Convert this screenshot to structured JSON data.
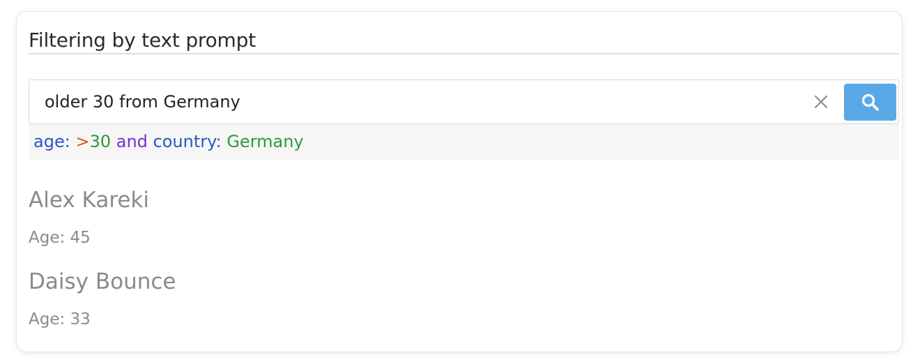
{
  "panel": {
    "title": "Filtering by text prompt"
  },
  "search": {
    "value": "older 30 from Germany",
    "placeholder": "",
    "clear_icon": "close-icon",
    "submit_icon": "search-icon",
    "button_color": "#5aa9e6"
  },
  "parsed_query": {
    "tokens": [
      {
        "text": "age",
        "role": "field",
        "color": "#2b55c9"
      },
      {
        "text": ":",
        "role": "separator",
        "color": "#2b55c9"
      },
      {
        "text": " ",
        "role": "space",
        "color": "#2b55c9"
      },
      {
        "text": ">",
        "role": "operator",
        "color": "#d4571c"
      },
      {
        "text": "30",
        "role": "value",
        "color": "#2d9a3a"
      },
      {
        "text": " ",
        "role": "space",
        "color": "#2b55c9"
      },
      {
        "text": "and",
        "role": "logical",
        "color": "#7b2fc9"
      },
      {
        "text": " ",
        "role": "space",
        "color": "#2b55c9"
      },
      {
        "text": "country",
        "role": "field",
        "color": "#2b55c9"
      },
      {
        "text": ":",
        "role": "separator",
        "color": "#2b55c9"
      },
      {
        "text": " ",
        "role": "space",
        "color": "#2b55c9"
      },
      {
        "text": "Germany",
        "role": "value",
        "color": "#2d9a3a"
      }
    ]
  },
  "results": [
    {
      "name": "Alex Kareki",
      "age_label": "Age: 45"
    },
    {
      "name": "Daisy Bounce",
      "age_label": "Age: 33"
    }
  ]
}
